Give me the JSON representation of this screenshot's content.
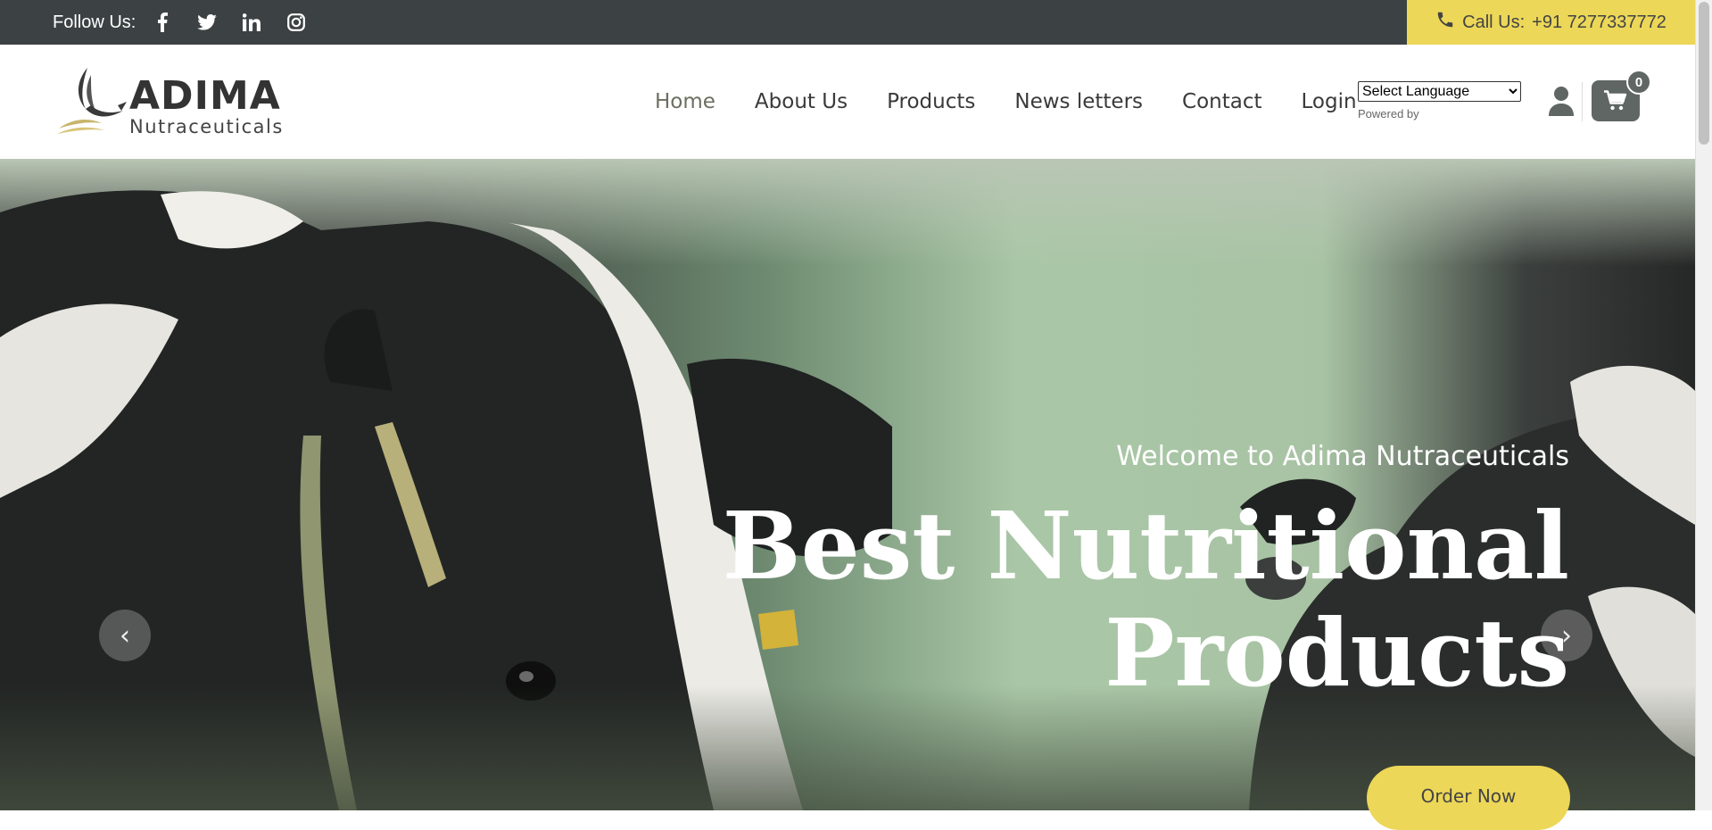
{
  "topbar": {
    "follow_label": "Follow Us:",
    "social": [
      "facebook-icon",
      "twitter-icon",
      "linkedin-icon",
      "instagram-icon"
    ],
    "call_label": "Call Us:",
    "phone": "+91 7277337772"
  },
  "header": {
    "logo_brand": "ADIMA",
    "logo_sub": "Nutraceuticals",
    "nav": [
      "Home",
      "About Us",
      "Products",
      "News letters",
      "Contact",
      "Login"
    ],
    "active_nav": "Home",
    "language_select": "Select Language",
    "powered_by": "Powered by",
    "cart_count": "0"
  },
  "hero": {
    "welcome": "Welcome to Adima Nutraceuticals",
    "headline_line1": "Best Nutritional",
    "headline_line2": "Products",
    "cta": "Order Now",
    "prev_symbol": "‹",
    "next_symbol": "›"
  },
  "colors": {
    "topbar_bg": "#3c4243",
    "accent_yellow": "#ecd758",
    "cart_bg": "#5f6663"
  }
}
